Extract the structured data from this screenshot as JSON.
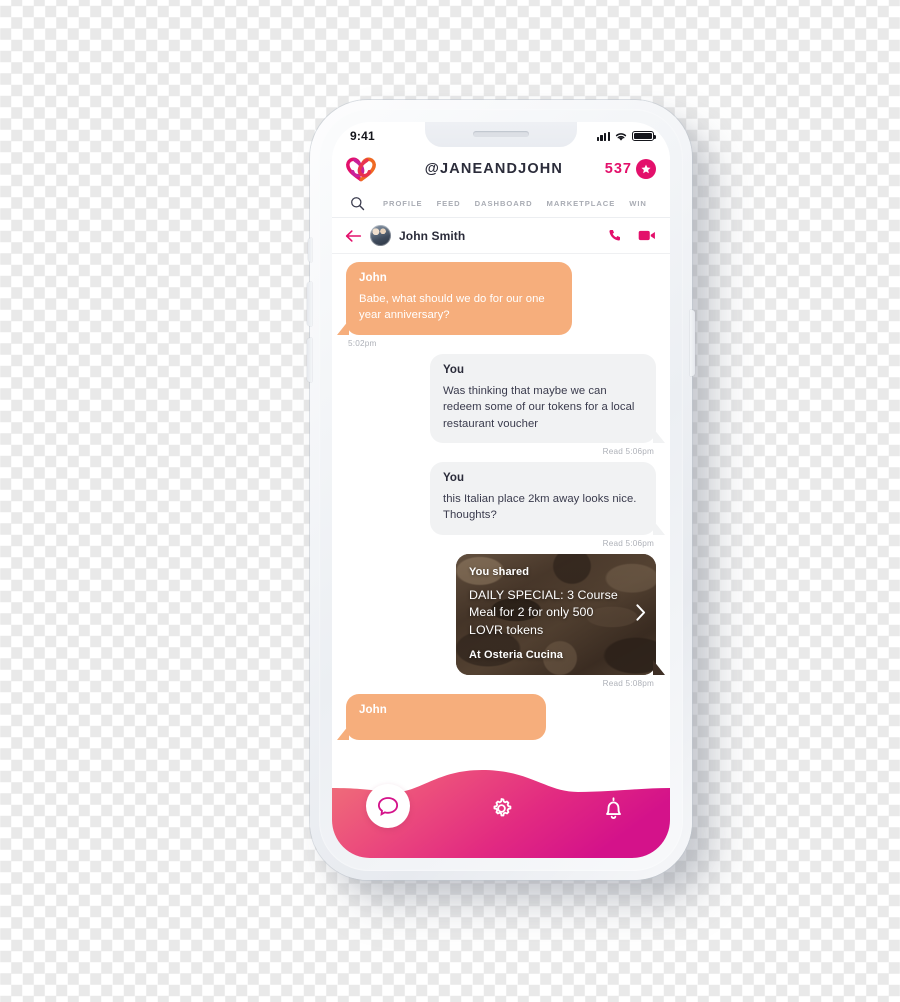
{
  "device": {
    "status_bar": {
      "time": "9:41",
      "signal_icon": "cellular-signal-icon",
      "wifi_icon": "wifi-icon",
      "battery_icon": "battery-full-icon"
    }
  },
  "app_header": {
    "logo_icon": "interlocking-hearts-logo",
    "handle": "@JANEANDJOHN",
    "token_count": "537",
    "token_badge_icon": "star-badge-icon",
    "accent_color": "#e3106b"
  },
  "nav_tabs": {
    "search_icon": "search-icon",
    "items": [
      {
        "label": "PROFILE"
      },
      {
        "label": "FEED"
      },
      {
        "label": "DASHBOARD"
      },
      {
        "label": "MARKETPLACE"
      },
      {
        "label": "WIN"
      }
    ]
  },
  "chat_header": {
    "back_icon": "back-arrow-icon",
    "avatar": "contact-avatar",
    "contact_name": "John Smith",
    "call_icon": "phone-call-icon",
    "video_icon": "video-camera-icon"
  },
  "messages": [
    {
      "direction": "incoming",
      "author": "John",
      "text": "Babe, what should we do for our one year anniversary?",
      "meta": "5:02pm"
    },
    {
      "direction": "outgoing",
      "author": "You",
      "text": "Was thinking that maybe we can redeem some of our tokens for a  local restaurant voucher",
      "meta": "Read 5:06pm"
    },
    {
      "direction": "outgoing",
      "author": "You",
      "text": "this Italian place 2km away looks nice. Thoughts?",
      "meta": "Read 5:06pm"
    },
    {
      "direction": "outgoing-card",
      "shared_label": "You shared",
      "headline": "DAILY SPECIAL: 3 Course Meal for 2 for only 500 LOVR tokens",
      "venue": "At Osteria Cucina",
      "chevron_icon": "chevron-right-icon",
      "meta": "Read 5:08pm"
    },
    {
      "direction": "incoming",
      "author": "John",
      "text": "",
      "meta": ""
    }
  ],
  "bottom_nav": {
    "gradient_start": "#ef6f78",
    "gradient_end": "#da1b80",
    "items": [
      {
        "icon": "chat-bubble-icon",
        "active": true
      },
      {
        "icon": "gear-settings-icon",
        "active": false
      },
      {
        "icon": "bell-notification-icon",
        "active": false
      }
    ]
  }
}
